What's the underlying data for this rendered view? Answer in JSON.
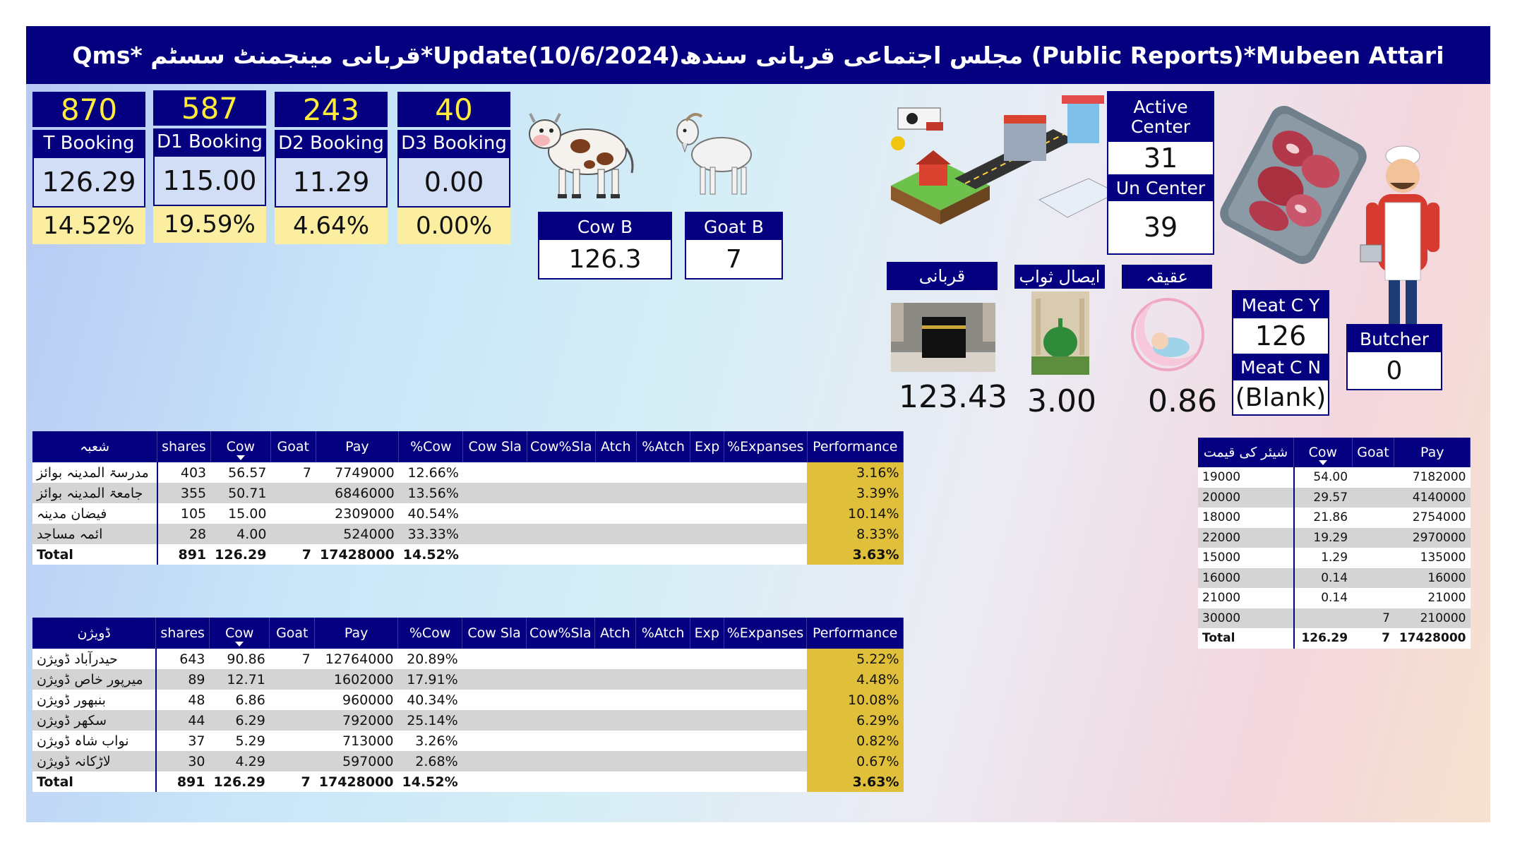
{
  "title": "Qms*  قربانی مینجمنٹ سسٹم*Update(10/6/2024)مجلس اجتماعی قربانی سندھ (Public Reports)*Mubeen Attari",
  "kpis": [
    {
      "count": "870",
      "label": "T Booking",
      "value": "126.29",
      "pct": "14.52%"
    },
    {
      "count": "587",
      "label": "D1 Booking",
      "value": "115.00",
      "pct": "19.59%"
    },
    {
      "count": "243",
      "label": "D2 Booking",
      "value": "11.29",
      "pct": "4.64%"
    },
    {
      "count": "40",
      "label": "D3 Booking",
      "value": "0.00",
      "pct": "0.00%"
    }
  ],
  "animals": {
    "cow": {
      "label": "Cow B",
      "value": "126.3"
    },
    "goat": {
      "label": "Goat B",
      "value": "7"
    }
  },
  "centers": {
    "active_label": "Active Center",
    "active_value": "31",
    "un_label": "Un Center",
    "un_value": "39"
  },
  "meat": {
    "y_label": "Meat C Y",
    "y_value": "126",
    "n_label": "Meat C N",
    "n_value": "(Blank)"
  },
  "butcher": {
    "label": "Butcher",
    "value": "0"
  },
  "categories": [
    {
      "label": "قربانی",
      "value": "123.43"
    },
    {
      "label": "ایصال ثواب",
      "value": "3.00"
    },
    {
      "label": "عقیقہ",
      "value": "0.86"
    }
  ],
  "table_headers": [
    "shares",
    "Cow",
    "Goat",
    "Pay",
    "%Cow",
    "Cow Sla",
    "Cow%Sla",
    "Atch",
    "%Atch",
    "Exp",
    "%Expanses",
    "Performance"
  ],
  "dept_table": {
    "first_header": "شعبہ",
    "rows": [
      {
        "name": "مدرسۃ المدینہ بوائز",
        "shares": "403",
        "cow": "56.57",
        "goat": "7",
        "pay": "7749000",
        "pcow": "12.66%",
        "perf": "3.16%"
      },
      {
        "name": "جامعۃ المدینہ بوائز",
        "shares": "355",
        "cow": "50.71",
        "goat": "",
        "pay": "6846000",
        "pcow": "13.56%",
        "perf": "3.39%"
      },
      {
        "name": "فیضان مدینہ",
        "shares": "105",
        "cow": "15.00",
        "goat": "",
        "pay": "2309000",
        "pcow": "40.54%",
        "perf": "10.14%"
      },
      {
        "name": "ائمہ مساجد",
        "shares": "28",
        "cow": "4.00",
        "goat": "",
        "pay": "524000",
        "pcow": "33.33%",
        "perf": "8.33%"
      }
    ],
    "total": {
      "name": "Total",
      "shares": "891",
      "cow": "126.29",
      "goat": "7",
      "pay": "17428000",
      "pcow": "14.52%",
      "perf": "3.63%"
    }
  },
  "div_table": {
    "first_header": "ڈویژن",
    "rows": [
      {
        "name": "حیدرآباد ڈویژن",
        "shares": "643",
        "cow": "90.86",
        "goat": "7",
        "pay": "12764000",
        "pcow": "20.89%",
        "perf": "5.22%"
      },
      {
        "name": "میرپور خاص ڈویژن",
        "shares": "89",
        "cow": "12.71",
        "goat": "",
        "pay": "1602000",
        "pcow": "17.91%",
        "perf": "4.48%"
      },
      {
        "name": "بنبھور ڈویژن",
        "shares": "48",
        "cow": "6.86",
        "goat": "",
        "pay": "960000",
        "pcow": "40.34%",
        "perf": "10.08%"
      },
      {
        "name": "سکھر ڈویژن",
        "shares": "44",
        "cow": "6.29",
        "goat": "",
        "pay": "792000",
        "pcow": "25.14%",
        "perf": "6.29%"
      },
      {
        "name": "نواب شاہ ڈویژن",
        "shares": "37",
        "cow": "5.29",
        "goat": "",
        "pay": "713000",
        "pcow": "3.26%",
        "perf": "0.82%"
      },
      {
        "name": "لاڑکانہ ڈویژن",
        "shares": "30",
        "cow": "4.29",
        "goat": "",
        "pay": "597000",
        "pcow": "2.68%",
        "perf": "0.67%"
      }
    ],
    "total": {
      "name": "Total",
      "shares": "891",
      "cow": "126.29",
      "goat": "7",
      "pay": "17428000",
      "pcow": "14.52%",
      "perf": "3.63%"
    }
  },
  "price_table": {
    "headers": [
      "شیئر کی قیمت",
      "Cow",
      "Goat",
      "Pay"
    ],
    "rows": [
      {
        "price": "19000",
        "cow": "54.00",
        "goat": "",
        "pay": "7182000"
      },
      {
        "price": "20000",
        "cow": "29.57",
        "goat": "",
        "pay": "4140000"
      },
      {
        "price": "18000",
        "cow": "21.86",
        "goat": "",
        "pay": "2754000"
      },
      {
        "price": "22000",
        "cow": "19.29",
        "goat": "",
        "pay": "2970000"
      },
      {
        "price": "15000",
        "cow": "1.29",
        "goat": "",
        "pay": "135000"
      },
      {
        "price": "16000",
        "cow": "0.14",
        "goat": "",
        "pay": "16000"
      },
      {
        "price": "21000",
        "cow": "0.14",
        "goat": "",
        "pay": "21000"
      },
      {
        "price": "30000",
        "cow": "",
        "goat": "7",
        "pay": "210000"
      }
    ],
    "total": {
      "price": "Total",
      "cow": "126.29",
      "goat": "7",
      "pay": "17428000"
    }
  },
  "colors": {
    "navy": "#05007f",
    "yellow_text": "#ffec3b",
    "pct_bg": "#fbeea0",
    "perf_bg": "#e0c03a"
  }
}
